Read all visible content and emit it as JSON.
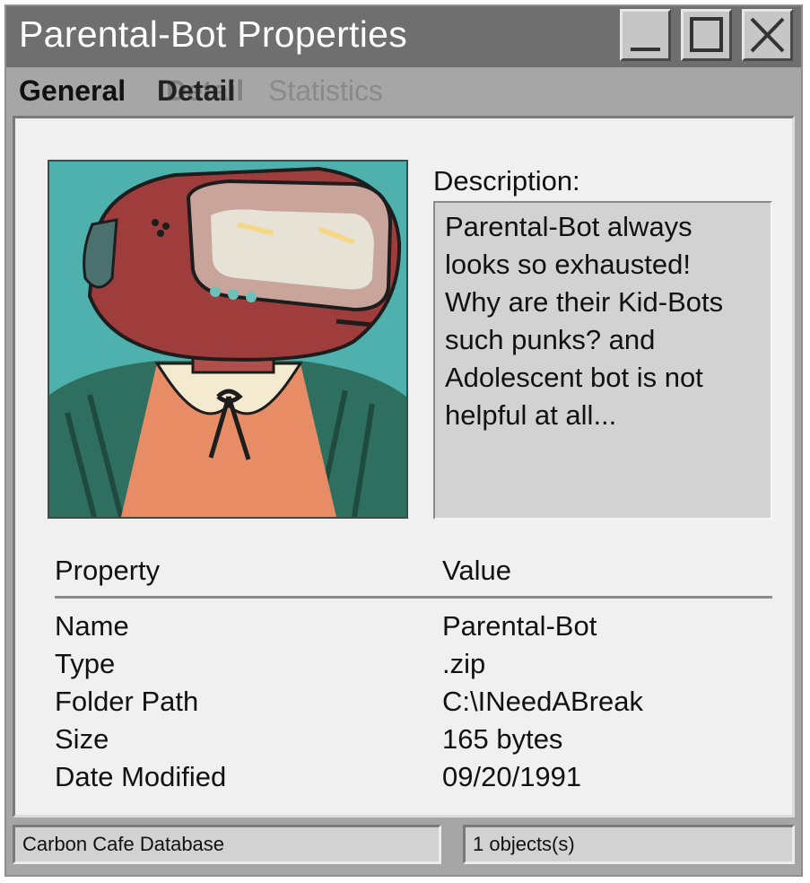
{
  "window": {
    "title": "Parental-Bot Properties",
    "controls": {
      "minimize": "minimize-icon",
      "maximize": "maximize-icon",
      "close": "close-icon"
    }
  },
  "tabs": [
    {
      "label": "General"
    },
    {
      "label": "Detail"
    },
    {
      "label": "Statistics"
    }
  ],
  "description": {
    "label": "Description:",
    "lines": [
      "Parental-Bot always",
      "looks so exhausted!",
      "Why are their Kid-Bots",
      "such punks? and",
      "Adolescent bot is not",
      "helpful at all..."
    ]
  },
  "properties": {
    "headers": {
      "property": "Property",
      "value": "Value"
    },
    "rows": [
      {
        "property": "Name",
        "value": "Parental-Bot"
      },
      {
        "property": "Type",
        "value": ".zip"
      },
      {
        "property": "Folder Path",
        "value": "C:\\INeedABreak"
      },
      {
        "property": "Size",
        "value": "165 bytes"
      },
      {
        "property": "Date Modified",
        "value": "09/20/1991"
      }
    ]
  },
  "status": {
    "left": "Carbon Cafe Database",
    "right": "1 objects(s)"
  },
  "colors": {
    "titlebar": "#6f6f6f",
    "window": "#a6a6a6",
    "panel": "#f0f0f0",
    "portrait_bg": "#4fb1ad"
  }
}
